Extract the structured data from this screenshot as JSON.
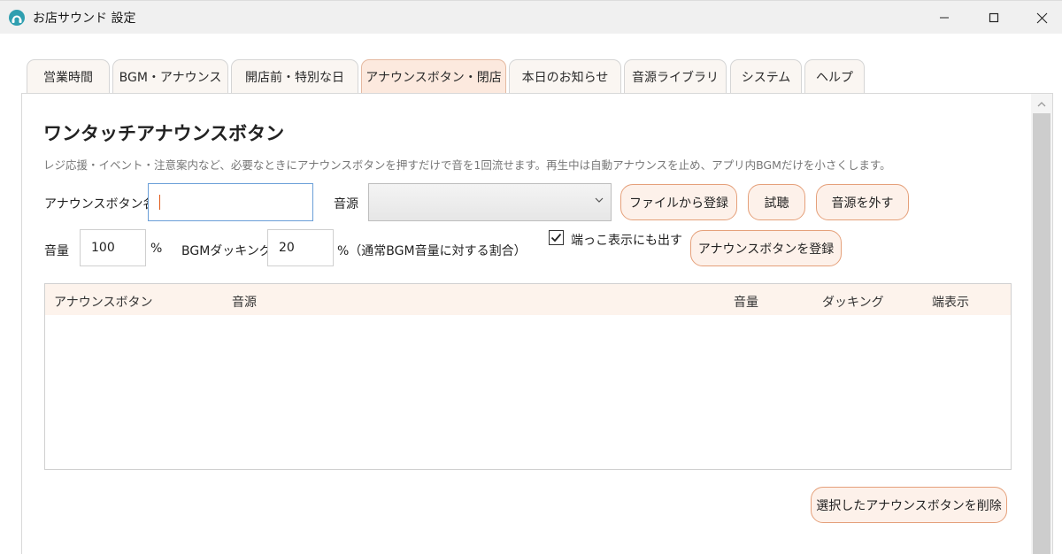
{
  "window": {
    "title": "お店サウンド 設定",
    "icon": "app-logo-icon"
  },
  "tabs": [
    {
      "label": "営業時間",
      "active": false
    },
    {
      "label": "BGM・アナウンス",
      "active": false
    },
    {
      "label": "開店前・特別な日",
      "active": false
    },
    {
      "label": "アナウンスボタン・閉店",
      "active": true
    },
    {
      "label": "本日のお知らせ",
      "active": false
    },
    {
      "label": "音源ライブラリ",
      "active": false
    },
    {
      "label": "システム",
      "active": false
    },
    {
      "label": "ヘルプ",
      "active": false
    }
  ],
  "section": {
    "title": "ワンタッチアナウンスボタン",
    "description": "レジ応援・イベント・注意案内など、必要なときにアナウンスボタンを押すだけで音を1回流せます。再生中は自動アナウンスを止め、アプリ内BGMだけを小さくします。"
  },
  "form": {
    "name_label": "アナウンスボタン名",
    "name_value": "",
    "source_label": "音源",
    "source_value": "",
    "register_from_file_button": "ファイルから登録",
    "preview_button": "試聴",
    "remove_source_button": "音源を外す",
    "volume_label": "音量",
    "volume_value": "100",
    "volume_unit": "%",
    "ducking_label": "BGMダッキング",
    "ducking_value": "20",
    "ducking_unit": "%（通常BGM音量に対する割合）",
    "edge_display_label": "端っこ表示にも出す",
    "edge_display_checked": true,
    "register_button": "アナウンスボタンを登録"
  },
  "table": {
    "columns": [
      "アナウンスボタン",
      "音源",
      "音量",
      "ダッキング",
      "端表示"
    ],
    "rows": []
  },
  "delete_button": "選択したアナウンスボタンを削除",
  "colors": {
    "accent_border": "#e5a07a",
    "button_bg": "#fdf1ea",
    "active_tab_bg": "#fce9de",
    "table_header_bg": "#fdf3ec"
  }
}
